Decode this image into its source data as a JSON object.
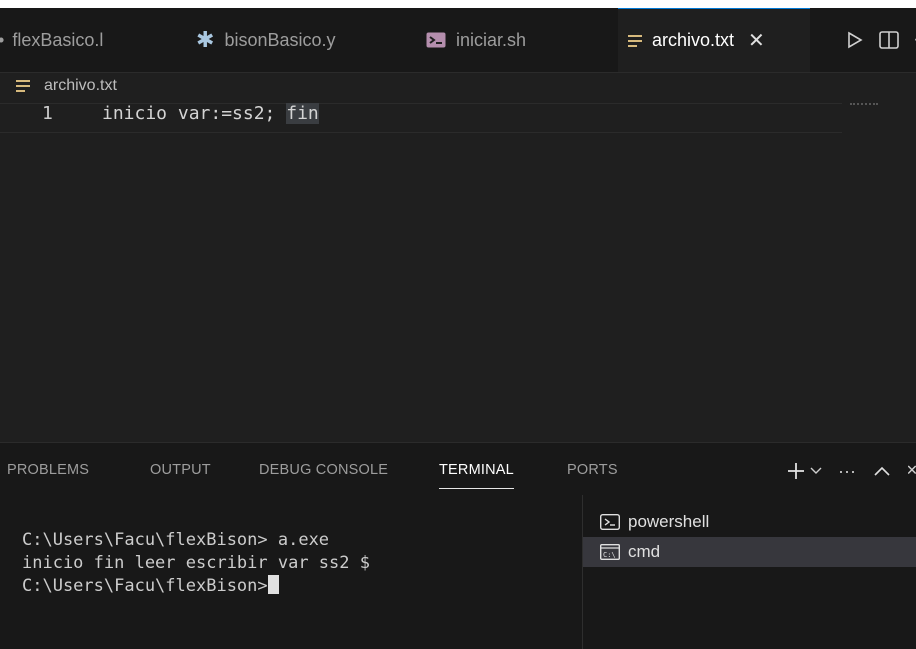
{
  "tabs": [
    {
      "label": "flexBasico.l",
      "icon": "lex-file-icon"
    },
    {
      "label": "bisonBasico.y",
      "icon": "asterisk-file-icon"
    },
    {
      "label": "iniciar.sh",
      "icon": "shell-script-icon"
    },
    {
      "label": "archivo.txt",
      "icon": "text-file-icon",
      "active": true
    }
  ],
  "breadcrumb": {
    "file": "archivo.txt"
  },
  "editor": {
    "line_number": "1",
    "code_before": "inicio var:=ss2; ",
    "code_highlight": "fin"
  },
  "panel": {
    "tabs": [
      "PROBLEMS",
      "OUTPUT",
      "DEBUG CONSOLE",
      "TERMINAL",
      "PORTS"
    ],
    "active_tab": "TERMINAL"
  },
  "terminal": {
    "lines": [
      "C:\\Users\\Facu\\flexBison> a.exe",
      "inicio fin leer escribir var ss2 $",
      "C:\\Users\\Facu\\flexBison>"
    ]
  },
  "terminal_list": [
    {
      "label": "powershell",
      "icon": "powershell-icon"
    },
    {
      "label": "cmd",
      "icon": "cmd-icon",
      "selected": true
    }
  ],
  "colors": {
    "accent": "#0078d4",
    "editor_bg": "#1f1f1f",
    "panel_bg": "#181818"
  }
}
